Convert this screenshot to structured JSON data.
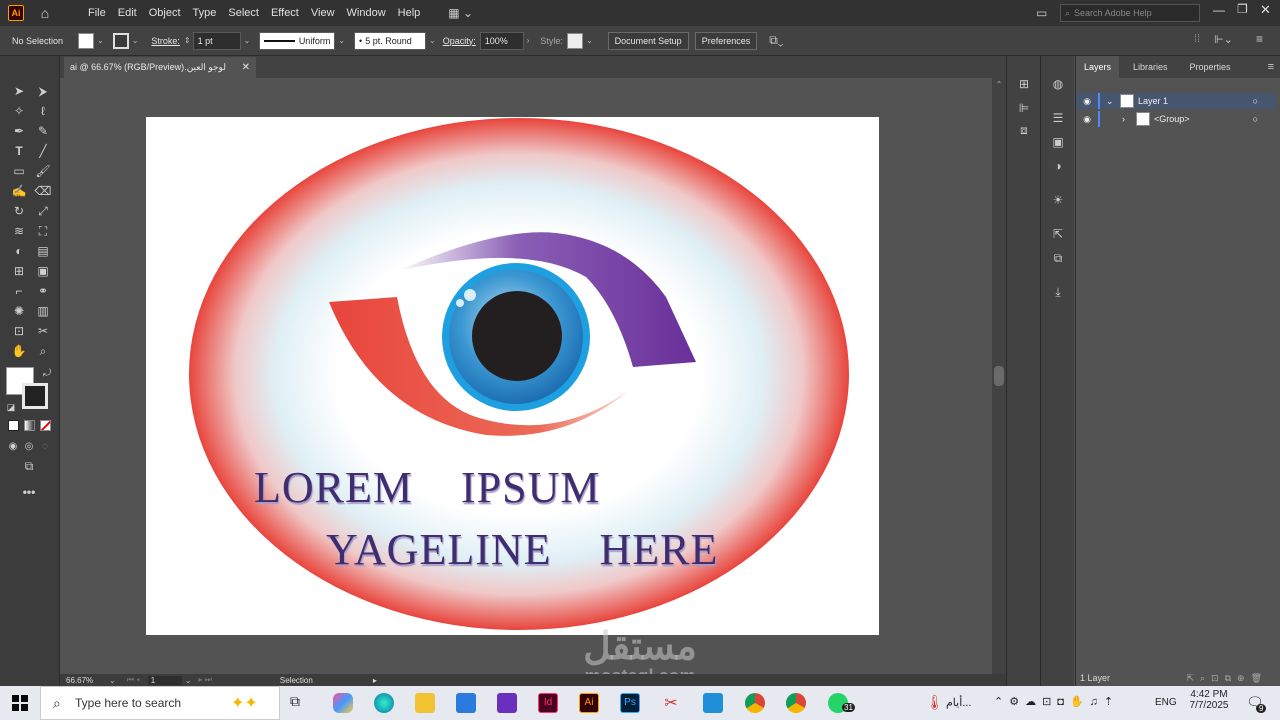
{
  "app": {
    "logo": "Ai",
    "home_icon": "home-icon"
  },
  "menu": [
    "File",
    "Edit",
    "Object",
    "Type",
    "Select",
    "Effect",
    "View",
    "Window",
    "Help"
  ],
  "search": {
    "placeholder": "Search Adobe Help"
  },
  "control_bar": {
    "selection_label": "No Selection",
    "stroke_label": "Stroke:",
    "stroke_weight": "1 pt",
    "stroke_profile": "Uniform",
    "brush": "5 pt. Round",
    "opacity_label": "Opacity:",
    "opacity_value": "100%",
    "style_label": "Style:",
    "document_setup": "Document Setup",
    "preferences": "Preferences"
  },
  "document_tab": {
    "title": "لوجو العين.ai @ 66.67% (RGB/Preview)"
  },
  "artwork": {
    "line1_word1": "LOREM",
    "line1_word2": "IPSUM",
    "line2_word1": "YAGELINE",
    "line2_word2": "HERE",
    "colors": {
      "red": "#e8453c",
      "purple": "#6a2f9a",
      "blue": "#2aa3dc",
      "pupil": "#231f20",
      "text": "#3a2a6a"
    }
  },
  "status_bar": {
    "zoom": "66.67%",
    "artboard": "1",
    "tool": "Selection"
  },
  "panels": {
    "tabs": [
      "Layers",
      "Libraries",
      "Properties"
    ],
    "layers": [
      {
        "name": "Layer 1",
        "expanded": true
      },
      {
        "name": "<Group>",
        "expanded": false
      }
    ],
    "footer": "1 Layer"
  },
  "taskbar": {
    "search_placeholder": "Type here to search",
    "notification_text": "أيام...",
    "language": "ENG",
    "time": "4:42 PM",
    "date": "7/7/2025",
    "whatsapp_badge": "31",
    "notification_count": "9"
  },
  "watermark": {
    "arabic": "مستقل",
    "latin": "mostaql.com"
  }
}
